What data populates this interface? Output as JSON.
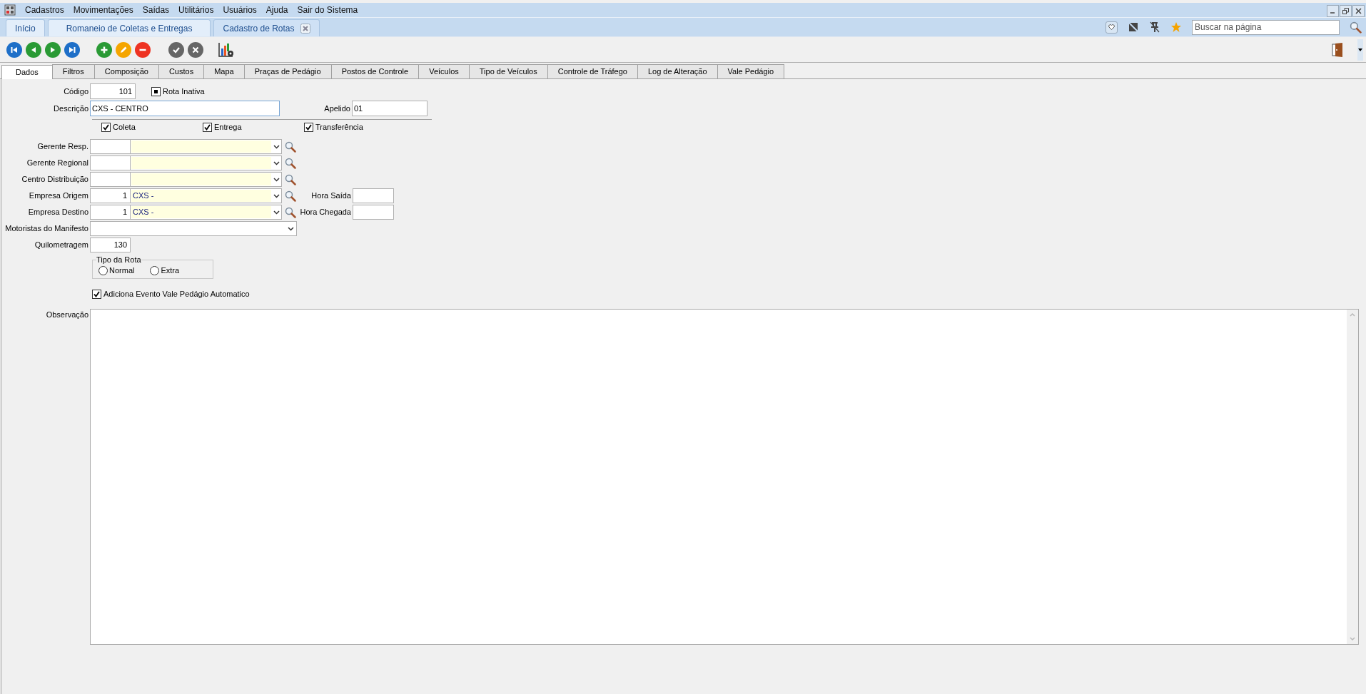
{
  "menu": [
    "Cadastros",
    "Movimentações",
    "Saídas",
    "Utilitários",
    "Usuários",
    "Ajuda",
    "Sair do Sistema"
  ],
  "doc_tabs": [
    {
      "label": "Início",
      "selected": false,
      "closable": false
    },
    {
      "label": "Romaneio de Coletas e Entregas",
      "selected": false,
      "closable": false
    },
    {
      "label": "Cadastro de Rotas",
      "selected": true,
      "closable": true
    }
  ],
  "search": {
    "placeholder": "Buscar na página"
  },
  "tabs": [
    {
      "label": "Dados",
      "selected": true
    },
    {
      "label": "Filtros",
      "selected": false
    },
    {
      "label": "Composição",
      "selected": false
    },
    {
      "label": "Custos",
      "selected": false
    },
    {
      "label": "Mapa",
      "selected": false
    },
    {
      "label": "Praças de Pedágio",
      "selected": false
    },
    {
      "label": "Postos de Controle",
      "selected": false
    },
    {
      "label": "Veículos",
      "selected": false
    },
    {
      "label": "Tipo de Veículos",
      "selected": false
    },
    {
      "label": "Controle de Tráfego",
      "selected": false
    },
    {
      "label": "Log de Alteração",
      "selected": false
    },
    {
      "label": "Vale Pedágio",
      "selected": false
    }
  ],
  "codigo": {
    "label": "Código",
    "value": "101"
  },
  "rota_inativa": {
    "label": "Rota Inativa",
    "indeterminate": true
  },
  "descricao": {
    "label": "Descrição",
    "value": "CXS - CENTRO"
  },
  "apelido": {
    "label": "Apelido",
    "value": "01"
  },
  "flags": [
    {
      "label": "Coleta",
      "checked": true
    },
    {
      "label": "Entrega",
      "checked": true
    },
    {
      "label": "Transferência",
      "checked": true
    }
  ],
  "lookups": [
    {
      "label": "Gerente Resp."
    },
    {
      "label": "Gerente Regional"
    },
    {
      "label": "Centro Distribuição"
    },
    {
      "label": "Empresa Origem",
      "code": "1",
      "value": "CXS -",
      "side_field": {
        "label": "Hora Saída"
      }
    },
    {
      "label": "Empresa Destino",
      "code": "1",
      "value": "CXS -",
      "side_field": {
        "label": "Hora Chegada"
      }
    }
  ],
  "motoristas": {
    "label": "Motoristas do Manifesto"
  },
  "quilometragem": {
    "label": "Quilometragem",
    "value": "130"
  },
  "tipo_rota": {
    "title": "Tipo da Rota",
    "options": [
      {
        "label": "Normal",
        "selected": false
      },
      {
        "label": "Extra",
        "selected": false
      }
    ]
  },
  "vale_pedagio": {
    "label": "Adiciona Evento Vale Pedágio Automatico",
    "checked": true
  },
  "observacao": {
    "label": "Observação"
  }
}
